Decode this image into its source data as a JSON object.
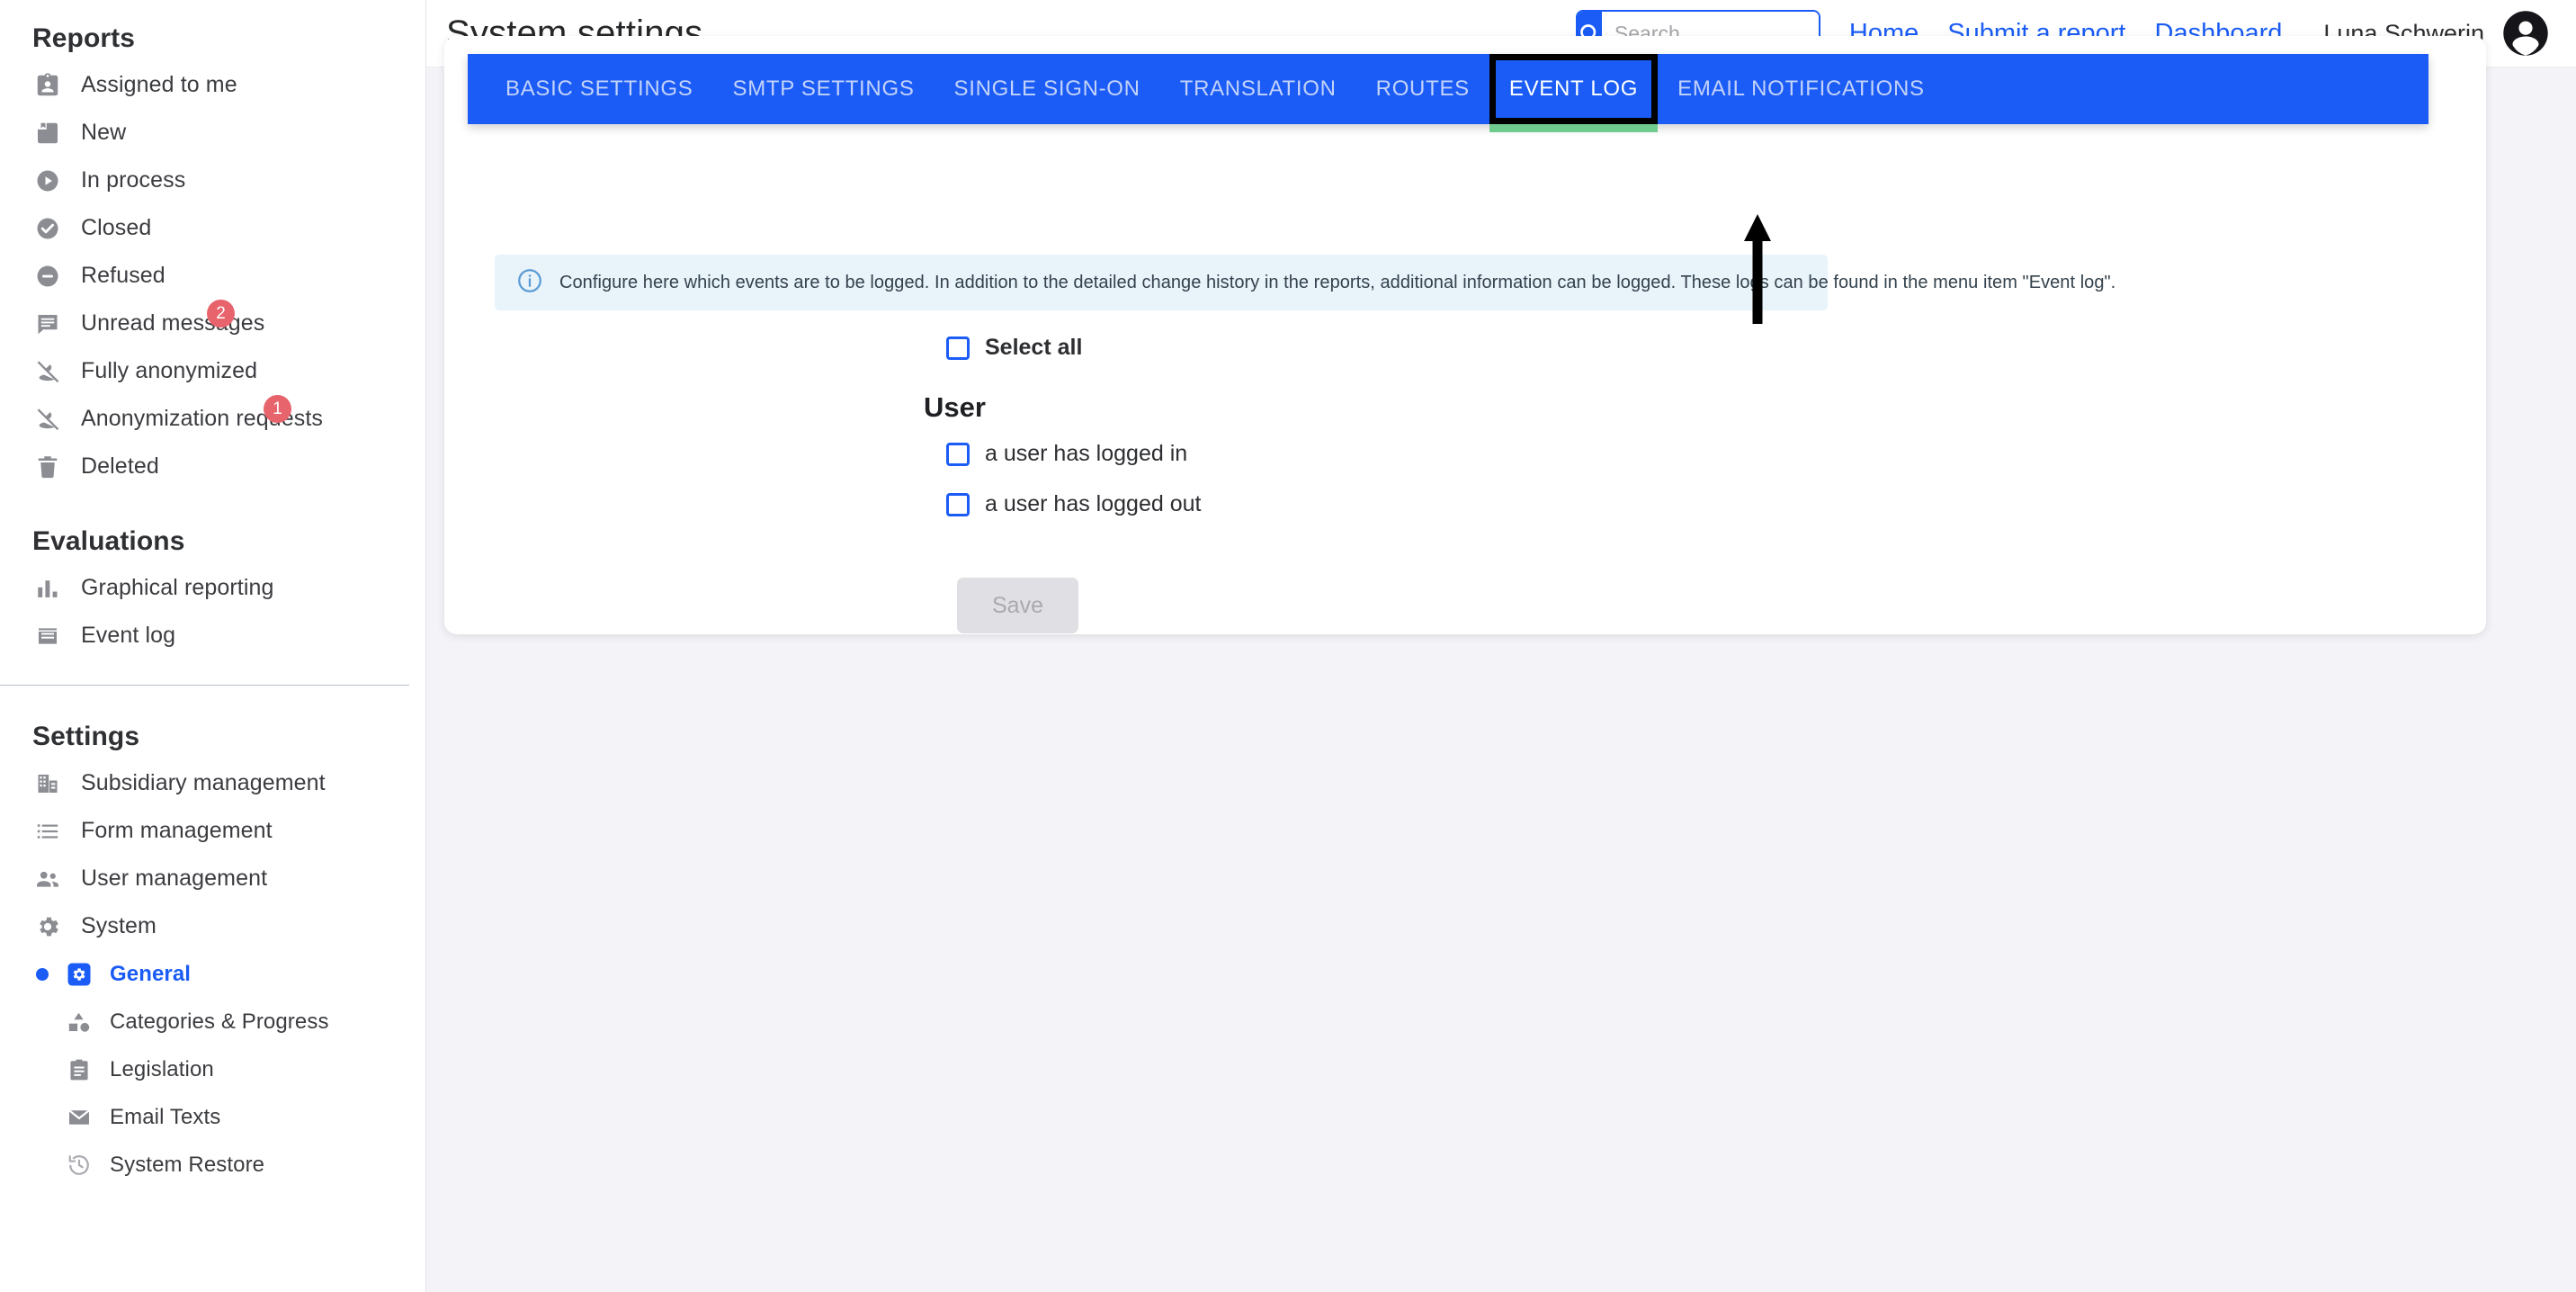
{
  "header": {
    "title": "System settings",
    "search": {
      "placeholder": "Search ...",
      "value": "",
      "icon": "search-icon"
    },
    "links": [
      {
        "label": "Home",
        "name": "home"
      },
      {
        "label": "Submit a report",
        "name": "submit-a-report"
      },
      {
        "label": "Dashboard",
        "name": "dashboard"
      }
    ],
    "user_name": "Luna Schwerin",
    "avatar_icon": "user-avatar-icon"
  },
  "sidebar": {
    "sections": [
      {
        "title": "Reports",
        "items": [
          {
            "label": "Assigned to me",
            "icon": "badge-person-icon",
            "badge": null
          },
          {
            "label": "New",
            "icon": "inbox-tray-icon",
            "badge": null
          },
          {
            "label": "In process",
            "icon": "play-circle-icon",
            "badge": null
          },
          {
            "label": "Closed",
            "icon": "check-circle-icon",
            "badge": null
          },
          {
            "label": "Refused",
            "icon": "minus-circle-icon",
            "badge": null
          },
          {
            "label": "Unread messages",
            "icon": "chat-bubble-icon",
            "badge": "2"
          },
          {
            "label": "Fully anonymized",
            "icon": "person-off-icon",
            "badge": null
          },
          {
            "label": "Anonymization requests",
            "icon": "person-off-icon",
            "badge": "1"
          },
          {
            "label": "Deleted",
            "icon": "trash-icon",
            "badge": null
          }
        ]
      },
      {
        "title": "Evaluations",
        "items": [
          {
            "label": "Graphical reporting",
            "icon": "bar-chart-icon",
            "badge": null
          },
          {
            "label": "Event log",
            "icon": "log-list-icon",
            "badge": null
          }
        ]
      },
      {
        "title": "Settings",
        "items": [
          {
            "label": "Subsidiary management",
            "icon": "building-icon",
            "badge": null
          },
          {
            "label": "Form management",
            "icon": "list-icon",
            "badge": null
          },
          {
            "label": "User management",
            "icon": "people-icon",
            "badge": null
          },
          {
            "label": "System",
            "icon": "gear-icon",
            "badge": null
          }
        ],
        "subitems": [
          {
            "label": "General",
            "icon": "gear-square-icon",
            "active": true
          },
          {
            "label": "Categories & Progress",
            "icon": "shapes-icon",
            "active": false
          },
          {
            "label": "Legislation",
            "icon": "clipboard-icon",
            "active": false
          },
          {
            "label": "Email Texts",
            "icon": "envelope-icon",
            "active": false
          },
          {
            "label": "System Restore",
            "icon": "history-restore-icon",
            "active": false
          }
        ]
      }
    ]
  },
  "main": {
    "tabs": [
      {
        "label": "BASIC SETTINGS",
        "selected": false
      },
      {
        "label": "SMTP SETTINGS",
        "selected": false
      },
      {
        "label": "SINGLE SIGN-ON",
        "selected": false
      },
      {
        "label": "TRANSLATION",
        "selected": false
      },
      {
        "label": "ROUTES",
        "selected": false
      },
      {
        "label": "EVENT LOG",
        "selected": true
      },
      {
        "label": "EMAIL NOTIFICATIONS",
        "selected": false
      }
    ],
    "info_banner": {
      "icon": "info-circle-icon",
      "text": "Configure here which events are to be logged. In addition to the detailed change history in the reports, additional information can be logged. These logs can be found in the menu item \"Event log\"."
    },
    "select_all": {
      "label": "Select all",
      "checked": false
    },
    "groups": [
      {
        "title": "User",
        "options": [
          {
            "label": "a user has logged in",
            "checked": false
          },
          {
            "label": "a user has logged out",
            "checked": false
          }
        ]
      }
    ],
    "save_button": {
      "label": "Save",
      "disabled": true
    }
  },
  "annotation": {
    "type": "arrow-up",
    "points_to": "EVENT LOG"
  },
  "colors": {
    "accent_blue": "#1a5cf5",
    "badge_red": "#e8646d",
    "tab_underline_green": "#6fcb8e",
    "info_bg": "#e8f3fa",
    "page_bg": "#f4f4f8"
  }
}
